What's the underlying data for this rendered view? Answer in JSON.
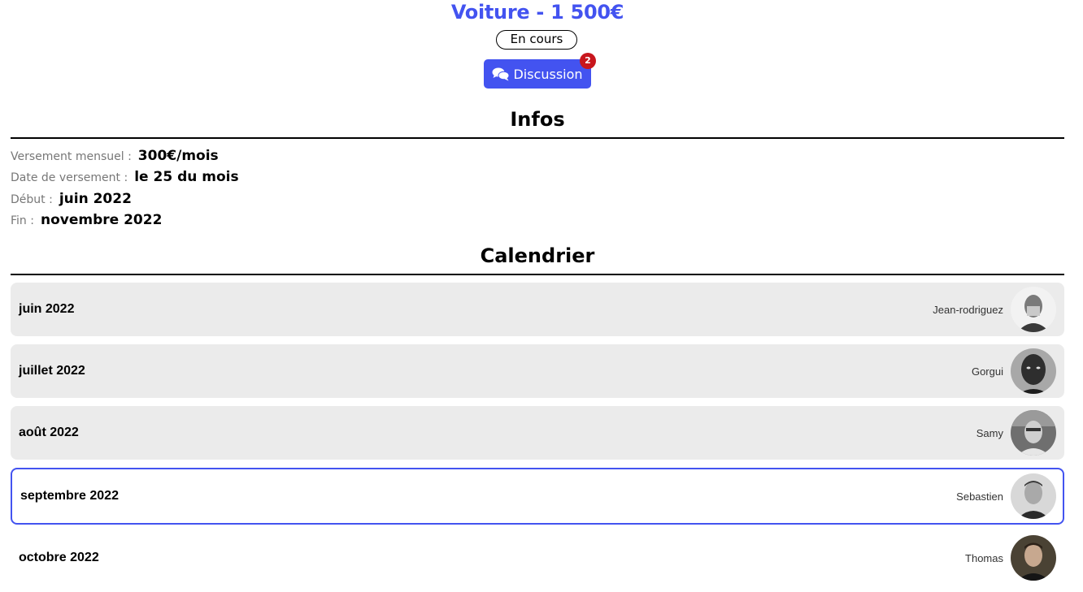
{
  "header": {
    "title": "Voiture - 1 500€",
    "status": "En cours",
    "discussion_label": "Discussion",
    "notification_count": "2",
    "accent_color": "#4353f0",
    "badge_color": "#c8161d"
  },
  "infos": {
    "title": "Infos",
    "items": [
      {
        "label": "Versement mensuel :",
        "value": "300€/mois"
      },
      {
        "label": "Date de versement :",
        "value": "le 25 du mois"
      },
      {
        "label": "Début :",
        "value": "juin 2022"
      },
      {
        "label": "Fin :",
        "value": "novembre 2022"
      }
    ]
  },
  "calendar": {
    "title": "Calendrier",
    "rows": [
      {
        "month": "juin 2022",
        "name": "Jean-rodriguez",
        "state": "past",
        "avatar": "avatar-photo"
      },
      {
        "month": "juillet 2022",
        "name": "Gorgui",
        "state": "past",
        "avatar": "avatar-photo"
      },
      {
        "month": "août 2022",
        "name": "Samy",
        "state": "past",
        "avatar": "avatar-photo"
      },
      {
        "month": "septembre 2022",
        "name": "Sebastien",
        "state": "current",
        "avatar": "avatar-photo"
      },
      {
        "month": "octobre 2022",
        "name": "Thomas",
        "state": "upcoming",
        "avatar": "avatar-photo"
      }
    ]
  }
}
